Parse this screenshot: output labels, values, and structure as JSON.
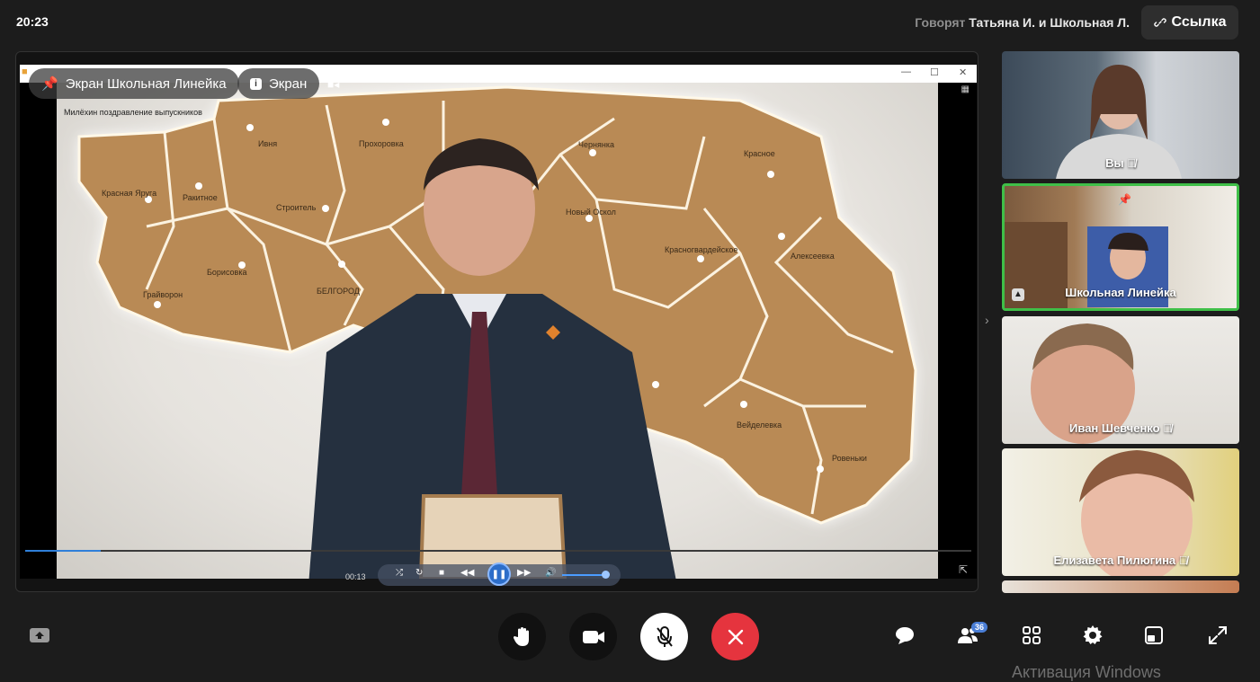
{
  "topbar": {
    "time": "20:23",
    "speaking_prefix": "Говорят",
    "speaking_names": "Татьяна И. и Школьная Л.",
    "link_label": "Ссылка"
  },
  "stage": {
    "share_chip_label": "Экран Школьная Линейка",
    "screen_chip_label": "Экран",
    "video_caption": "Милёхин поздравление выпускников",
    "player_time": "00:13",
    "progress": 0.08,
    "volume": 0.85,
    "map_labels": [
      "Красная Яруга",
      "Ракитное",
      "Ивня",
      "Прохоровка",
      "Чернянка",
      "Красное",
      "Строитель",
      "Новый Оскол",
      "Борисовка",
      "Красногвардейское",
      "Алексеевка",
      "Грайворон",
      "БЕЛГОРОД",
      "Вейделевка",
      "Ровеньки"
    ]
  },
  "participants": [
    {
      "name": "Вы",
      "muted": true,
      "active": false,
      "pinned": false
    },
    {
      "name": "Школьная Линейка",
      "muted": false,
      "active": true,
      "pinned": true
    },
    {
      "name": "Иван Шевченко",
      "muted": true,
      "active": false,
      "pinned": false
    },
    {
      "name": "Елизавета Пилюгина",
      "muted": true,
      "active": false,
      "pinned": false
    }
  ],
  "bottombar": {
    "participants_count": "36",
    "accent_red": "#e5343e",
    "active_tile_color": "#3fbf48"
  },
  "watermark": "Активация Windows"
}
